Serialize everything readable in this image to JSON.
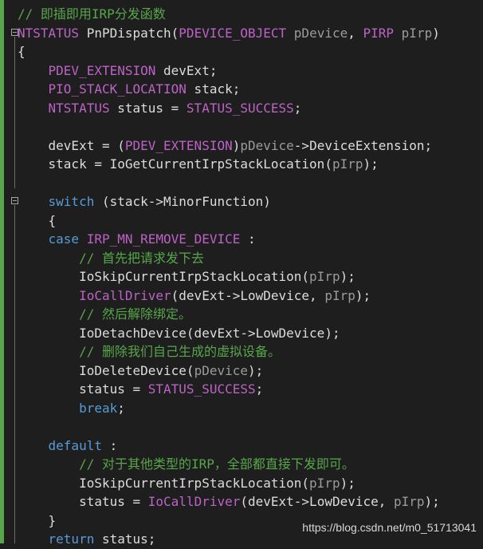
{
  "code": {
    "lines": [
      [
        {
          "t": "// 即插即用IRP分发函数",
          "c": "cm"
        }
      ],
      [
        {
          "t": "NTSTATUS",
          "c": "mac"
        },
        {
          "t": " PnPDispatch(",
          "c": "pl"
        },
        {
          "t": "PDEVICE_OBJECT",
          "c": "mac"
        },
        {
          "t": " ",
          "c": "pl"
        },
        {
          "t": "pDevice",
          "c": "par"
        },
        {
          "t": ", ",
          "c": "pl"
        },
        {
          "t": "PIRP",
          "c": "mac"
        },
        {
          "t": " ",
          "c": "pl"
        },
        {
          "t": "pIrp",
          "c": "par"
        },
        {
          "t": ")",
          "c": "pl"
        }
      ],
      [
        {
          "t": "{",
          "c": "pl"
        }
      ],
      [
        {
          "t": "    ",
          "c": "pl"
        },
        {
          "t": "PDEV_EXTENSION",
          "c": "mac"
        },
        {
          "t": " devExt;",
          "c": "pl"
        }
      ],
      [
        {
          "t": "    ",
          "c": "pl"
        },
        {
          "t": "PIO_STACK_LOCATION",
          "c": "mac"
        },
        {
          "t": " stack;",
          "c": "pl"
        }
      ],
      [
        {
          "t": "    ",
          "c": "pl"
        },
        {
          "t": "NTSTATUS",
          "c": "mac"
        },
        {
          "t": " status = ",
          "c": "pl"
        },
        {
          "t": "STATUS_SUCCESS",
          "c": "mac"
        },
        {
          "t": ";",
          "c": "pl"
        }
      ],
      [
        {
          "t": "",
          "c": "pl"
        }
      ],
      [
        {
          "t": "    devExt = (",
          "c": "pl"
        },
        {
          "t": "PDEV_EXTENSION",
          "c": "mac"
        },
        {
          "t": ")",
          "c": "pl"
        },
        {
          "t": "pDevice",
          "c": "par"
        },
        {
          "t": "->DeviceExtension;",
          "c": "pl"
        }
      ],
      [
        {
          "t": "    stack = IoGetCurrentIrpStackLocation(",
          "c": "pl"
        },
        {
          "t": "pIrp",
          "c": "par"
        },
        {
          "t": ");",
          "c": "pl"
        }
      ],
      [
        {
          "t": "",
          "c": "pl"
        }
      ],
      [
        {
          "t": "    ",
          "c": "pl"
        },
        {
          "t": "switch",
          "c": "kw"
        },
        {
          "t": " (stack->MinorFunction)",
          "c": "pl"
        }
      ],
      [
        {
          "t": "    {",
          "c": "pl"
        }
      ],
      [
        {
          "t": "    ",
          "c": "pl"
        },
        {
          "t": "case",
          "c": "kw"
        },
        {
          "t": " ",
          "c": "pl"
        },
        {
          "t": "IRP_MN_REMOVE_DEVICE",
          "c": "mac"
        },
        {
          "t": " :",
          "c": "pl"
        }
      ],
      [
        {
          "t": "        ",
          "c": "pl"
        },
        {
          "t": "// 首先把请求发下去",
          "c": "cm"
        }
      ],
      [
        {
          "t": "        IoSkipCurrentIrpStackLocation(",
          "c": "pl"
        },
        {
          "t": "pIrp",
          "c": "par"
        },
        {
          "t": ");",
          "c": "pl"
        }
      ],
      [
        {
          "t": "        ",
          "c": "pl"
        },
        {
          "t": "IoCallDriver",
          "c": "mac"
        },
        {
          "t": "(devExt->LowDevice, ",
          "c": "pl"
        },
        {
          "t": "pIrp",
          "c": "par"
        },
        {
          "t": ");",
          "c": "pl"
        }
      ],
      [
        {
          "t": "        ",
          "c": "pl"
        },
        {
          "t": "// 然后解除绑定。",
          "c": "cm"
        }
      ],
      [
        {
          "t": "        IoDetachDevice(devExt->LowDevice);",
          "c": "pl"
        }
      ],
      [
        {
          "t": "        ",
          "c": "pl"
        },
        {
          "t": "// 删除我们自己生成的虚拟设备。",
          "c": "cm"
        }
      ],
      [
        {
          "t": "        IoDeleteDevice(",
          "c": "pl"
        },
        {
          "t": "pDevice",
          "c": "par"
        },
        {
          "t": ");",
          "c": "pl"
        }
      ],
      [
        {
          "t": "        status = ",
          "c": "pl"
        },
        {
          "t": "STATUS_SUCCESS",
          "c": "mac"
        },
        {
          "t": ";",
          "c": "pl"
        }
      ],
      [
        {
          "t": "        ",
          "c": "pl"
        },
        {
          "t": "break",
          "c": "kw"
        },
        {
          "t": ";",
          "c": "pl"
        }
      ],
      [
        {
          "t": "",
          "c": "pl"
        }
      ],
      [
        {
          "t": "    ",
          "c": "pl"
        },
        {
          "t": "default",
          "c": "kw"
        },
        {
          "t": " :",
          "c": "pl"
        }
      ],
      [
        {
          "t": "        ",
          "c": "pl"
        },
        {
          "t": "// 对于其他类型的IRP，全部都直接下发即可。",
          "c": "cm"
        }
      ],
      [
        {
          "t": "        IoSkipCurrentIrpStackLocation(",
          "c": "pl"
        },
        {
          "t": "pIrp",
          "c": "par"
        },
        {
          "t": ");",
          "c": "pl"
        }
      ],
      [
        {
          "t": "        status = ",
          "c": "pl"
        },
        {
          "t": "IoCallDriver",
          "c": "mac"
        },
        {
          "t": "(devExt->LowDevice, ",
          "c": "pl"
        },
        {
          "t": "pIrp",
          "c": "par"
        },
        {
          "t": ");",
          "c": "pl"
        }
      ],
      [
        {
          "t": "    }",
          "c": "pl"
        }
      ],
      [
        {
          "t": "    ",
          "c": "pl"
        },
        {
          "t": "return",
          "c": "kw"
        },
        {
          "t": " status;",
          "c": "pl"
        }
      ]
    ]
  },
  "watermark": "https://blog.csdn.net/m0_51713041",
  "colors": {
    "background": "#1e1e1e",
    "keyword": "#569cd6",
    "macro": "#bd63c5",
    "comment": "#57a64a",
    "parameter": "#9b9b9b",
    "text": "#dcdcdc",
    "change_bar": "#57a64a"
  },
  "icons": [
    "fold-collapse-icon"
  ]
}
